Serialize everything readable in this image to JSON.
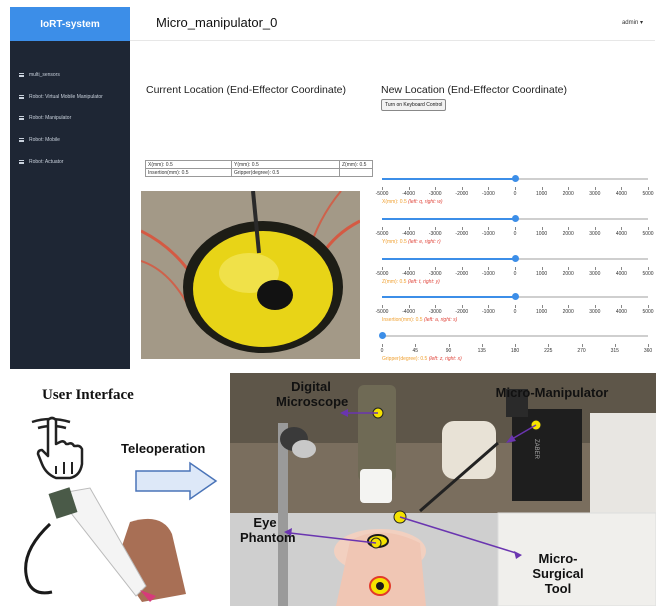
{
  "app": {
    "brand": "IoRT-system",
    "page_title": "Micro_manipulator_0",
    "user_menu": "admin ▾"
  },
  "sidebar": {
    "items": [
      {
        "label": "multi_sensors",
        "icon": "list-icon"
      },
      {
        "label": "Robot: Virtual Mobile Manipulator",
        "icon": "list-icon"
      },
      {
        "label": "Robot: Manipulator",
        "icon": "list-icon"
      },
      {
        "label": "Robot: Mobile",
        "icon": "list-icon"
      },
      {
        "label": "Robot: Actuator",
        "icon": "list-icon"
      }
    ]
  },
  "current": {
    "title": "Current Location (End-Effector Coordinate)",
    "cells": {
      "x": "X(mm): 0.5",
      "y": "Y(mm): 0.5",
      "z": "Z(mm): 0.5",
      "insertion": "Insertion(mm): 0.5",
      "gripper": "Gripper(degree): 0.5"
    }
  },
  "newloc": {
    "title": "New Location (End-Effector Coordinate)",
    "keyboard_button": "Turn on Keyboard Control",
    "sliders": [
      {
        "label": "X(mm): 0.5",
        "hint": "(left: q, right: w)",
        "min": -5000,
        "max": 5000,
        "value": 0.5,
        "ticks": [
          "-5000",
          "-4000",
          "-3000",
          "-2000",
          "-1000",
          "0",
          "1000",
          "2000",
          "3000",
          "4000",
          "5000"
        ]
      },
      {
        "label": "Y(mm): 0.5",
        "hint": "(left: e, right: r)",
        "min": -5000,
        "max": 5000,
        "value": 0.5,
        "ticks": [
          "-5000",
          "-4000",
          "-3000",
          "-2000",
          "-1000",
          "0",
          "1000",
          "2000",
          "3000",
          "4000",
          "5000"
        ]
      },
      {
        "label": "Z(mm): 0.5",
        "hint": "(left: t, right: y)",
        "min": -5000,
        "max": 5000,
        "value": 0.5,
        "ticks": [
          "-5000",
          "-4000",
          "-3000",
          "-2000",
          "-1000",
          "0",
          "1000",
          "2000",
          "3000",
          "4000",
          "5000"
        ]
      },
      {
        "label": "Insertion(mm): 0.5",
        "hint": "(left: a, right: s)",
        "min": -5000,
        "max": 5000,
        "value": 0.5,
        "ticks": [
          "-5000",
          "-4000",
          "-3000",
          "-2000",
          "-1000",
          "0",
          "1000",
          "2000",
          "3000",
          "4000",
          "5000"
        ]
      },
      {
        "label": "Gripper(degree): 0.5",
        "hint": "(left: z, right: x)",
        "min": 0,
        "max": 360,
        "value": 0.5,
        "ticks": [
          "0",
          "45",
          "90",
          "135",
          "180",
          "225",
          "270",
          "315",
          "360"
        ]
      }
    ]
  },
  "figure": {
    "user_interface": "User Interface",
    "teleoperation": "Teleoperation",
    "digital_microscope": "Digital Microscope",
    "micro_manipulator": "Micro-Manipulator",
    "eye_phantom": "Eye Phantom",
    "micro_surgical_tool": "Micro-Surgical Tool",
    "device_text": "ZABER"
  },
  "colors": {
    "brand": "#3c8ee8",
    "sidebar_bg": "#1e2634",
    "slider_label": "#f0a030",
    "slider_hint": "#e0463c",
    "marker": "#f5e200",
    "arrow": "#6a35b0"
  }
}
